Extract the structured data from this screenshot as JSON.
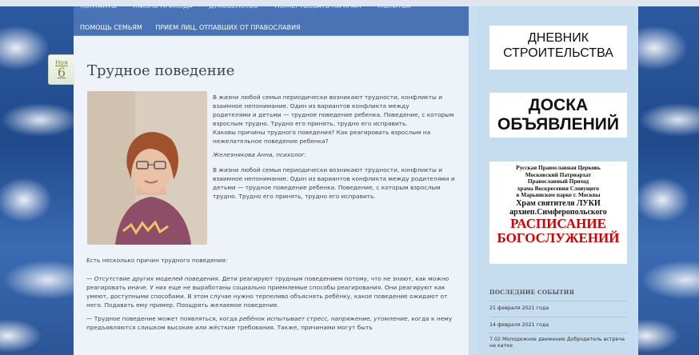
{
  "nav": {
    "row1": [
      "КОНТАКТЫ",
      "ЖИЗНЬ ПРИХОДА",
      "ДУХОВЕНСТВО",
      "ПОЖЕРТВОВАТЬ НА ХРАМ",
      "МОЛИТВА"
    ],
    "row2": [
      "ПОМОЩЬ СЕМЬЯМ",
      "ПРИЕМ ЛИЦ, ОТПАВШИХ ОТ ПРАВОСЛАВИЯ"
    ]
  },
  "post": {
    "date_month": "Ноя",
    "date_day": "6",
    "title": "Трудное поведение",
    "intro_1": "В жизни любой семьи периодически возникают трудности, конфликты и взаимное непонимание. Один из вариантов конфликта между",
    "intro_2": "родителями и детьми — трудное поведение ребенка. Поведение, с которым взрослым трудно. Трудно его принять, трудно его исправить.",
    "intro_3": "Каковы причины трудного поведения? Как реагировать взрослым на нежелательное поведение ребенка?",
    "author": "Железнякова Анна, психолог.",
    "para_repeat": "В жизни любой семьи периодически возникают трудности, конфликты и взаимное непонимание. Один из вариантов конфликта между родителями и детьми — трудное поведение ребенка. Поведение, с которым взрослым трудно. Трудно его принять, трудно его исправить.",
    "reasons_intro": "Есть несколько причин трудного поведения:",
    "reason1_lead": "— ",
    "reason1_italic": "Отсутствие других моделей поведения",
    "reason1_text": ". Дети реагируют трудным поведением потому, что не знают, как можно реагировать иначе. У них еще не выработаны социально приемлемые способы реагирования. Они реагируют как умеют, доступными способами. В этом случае нужно терпеливо объяснять ребёнку, какое поведение ожидают от него. Подавать ему пример. Поощрять желаемое поведение.",
    "reason2_lead": "— Трудное поведение может появляться, когда ",
    "reason2_italic": "ребёнок испытывает стресс, напряжение, утомление",
    "reason2_text": ", когда к нему предъявляются слишком высокие или жёсткие требования. Также, причинами могут быть"
  },
  "sidebar": {
    "banner1_line1": "ДНЕВНИК",
    "banner1_line2": "СТРОИТЕЛЬСТВА",
    "banner2_line1": "ДОСКА",
    "banner2_line2": "ОБЪЯВЛЕНИЙ",
    "banner3_l1": "Русская Православная Церковь",
    "banner3_l2": "Московский Патриархат",
    "banner3_l3": "Православный Приход",
    "banner3_l4": "храма Воскресения Словущего",
    "banner3_l5": "в Марьинском парке г. Москвы",
    "banner3_l6": "Храм святителя ЛУКИ",
    "banner3_l7": "архиеп.Симферопольского",
    "banner3_l8": "РАСПИСАНИЕ",
    "banner3_l9": "БОГОСЛУЖЕНИЙ",
    "events_heading": "ПОСЛЕДНИЕ СОБЫТИЯ",
    "events": [
      "21 февраля 2021 года",
      "14 февраля 2021 года",
      "7.02 Молодежное движение Добродетель встреча на катке"
    ]
  },
  "colors": {
    "nav_bg": "#4a73b5",
    "accent_red": "#d10000",
    "date_green": "#7b8a4a"
  }
}
